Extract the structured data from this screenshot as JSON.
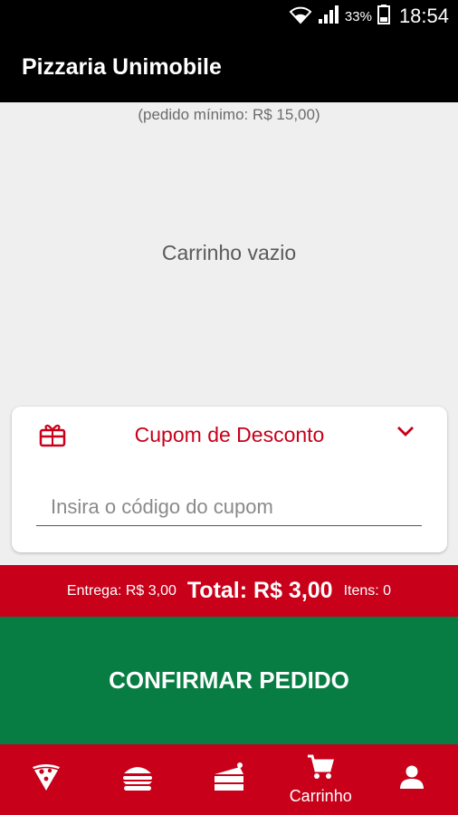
{
  "status_bar": {
    "battery": "33%",
    "time": "18:54"
  },
  "app": {
    "title": "Pizzaria Unimobile"
  },
  "cart": {
    "minimum_order": "(pedido mínimo: R$ 15,00)",
    "empty_message": "Carrinho vazio"
  },
  "coupon": {
    "title": "Cupom de Desconto",
    "placeholder": "Insira o código do cupom",
    "value": ""
  },
  "totals": {
    "delivery": "Entrega: R$ 3,00",
    "total": "Total: R$  3,00",
    "items": "Itens: 0"
  },
  "confirm_label": "CONFIRMAR PEDIDO",
  "bottom_nav": [
    {
      "icon": "pizza-icon",
      "label": ""
    },
    {
      "icon": "burger-icon",
      "label": ""
    },
    {
      "icon": "cake-icon",
      "label": ""
    },
    {
      "icon": "cart-icon",
      "label": "Carrinho"
    },
    {
      "icon": "person-icon",
      "label": ""
    }
  ],
  "colors": {
    "primary_red": "#c8001a",
    "confirm_green": "#077d43",
    "header_black": "#000000"
  }
}
